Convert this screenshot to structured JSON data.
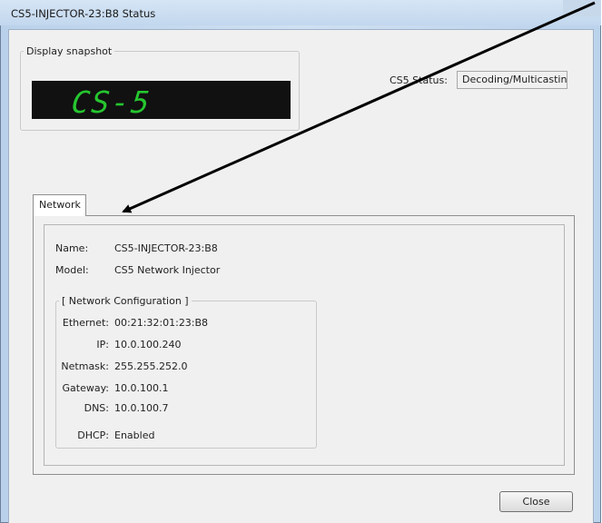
{
  "window": {
    "title": "CS5-INJECTOR-23:B8 Status"
  },
  "display_snapshot": {
    "legend": "Display snapshot",
    "lcd_text": "CS-5"
  },
  "status": {
    "label": "CS5 Status:",
    "value": "Decoding/Multicasting"
  },
  "tabs": [
    {
      "label": "Network"
    }
  ],
  "network": {
    "name_label": "Name:",
    "name_value": "CS5-INJECTOR-23:B8",
    "model_label": "Model:",
    "model_value": "CS5 Network Injector",
    "config_legend": "[ Network Configuration ]",
    "ethernet_label": "Ethernet:",
    "ethernet_value": "00:21:32:01:23:B8",
    "ip_label": "IP:",
    "ip_value": "10.0.100.240",
    "netmask_label": "Netmask:",
    "netmask_value": "255.255.252.0",
    "gateway_label": "Gateway:",
    "gateway_value": "10.0.100.1",
    "dns_label": "DNS:",
    "dns_value": "10.0.100.7",
    "dhcp_label": "DHCP:",
    "dhcp_value": "Enabled"
  },
  "buttons": {
    "close": "Close"
  },
  "colors": {
    "lcd_background": "#111111",
    "lcd_segments": "#26c62f",
    "annotation_arrow": "#000000"
  }
}
